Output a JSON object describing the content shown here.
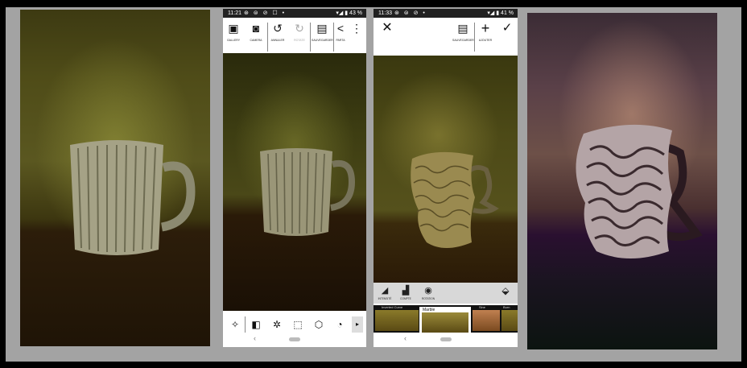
{
  "phone1": {
    "status": {
      "time": "11:21",
      "icons": "⊛ ⊜ ⊘ ☐ •",
      "right": "▾◢ ▮ 43 %"
    },
    "toolbar": [
      {
        "label": "GALLERY",
        "icon": "image-icon"
      },
      {
        "label": "CAMERA",
        "icon": "camera-icon"
      },
      {
        "label": "ANNULER",
        "icon": "undo-icon"
      },
      {
        "label": "ROTATE",
        "icon": "redo-icon"
      },
      {
        "label": "SAUVEGARDER",
        "icon": "save-icon"
      },
      {
        "label": "PARTA",
        "icon": "share-icon"
      }
    ],
    "bottom": [
      {
        "label": "PRESETS",
        "icon": "magic-wand-icon"
      },
      {
        "label": "MIRROR",
        "icon": "mirror-icon"
      },
      {
        "label": "COMPLEXE",
        "icon": "aperture-icon"
      },
      {
        "label": "DISTORTION",
        "icon": "distortion-icon"
      },
      {
        "label": "3D",
        "icon": "cube-icon"
      },
      {
        "label": "POLAIRES",
        "icon": "polar-icon"
      }
    ]
  },
  "phone2": {
    "status": {
      "time": "11:33",
      "icons": "⊛ ⊜ ⊘ •",
      "right": "▾◢ ▮ 41 %"
    },
    "toolbar": [
      {
        "label": "SAUVEGARDER",
        "icon": "save-icon"
      },
      {
        "label": "AJOUTER",
        "icon": "plus-icon"
      }
    ],
    "controls": [
      {
        "label": "INTENSITÉ",
        "icon": "intensity-icon"
      },
      {
        "label": "COMPTE",
        "icon": "count-icon"
      },
      {
        "label": "ROTATION",
        "icon": "rotation-icon"
      }
    ],
    "thumbs": [
      {
        "label": "Inverted Curve"
      },
      {
        "label": "Marble"
      },
      {
        "label": "Sine"
      },
      {
        "label": "Burn"
      }
    ]
  }
}
